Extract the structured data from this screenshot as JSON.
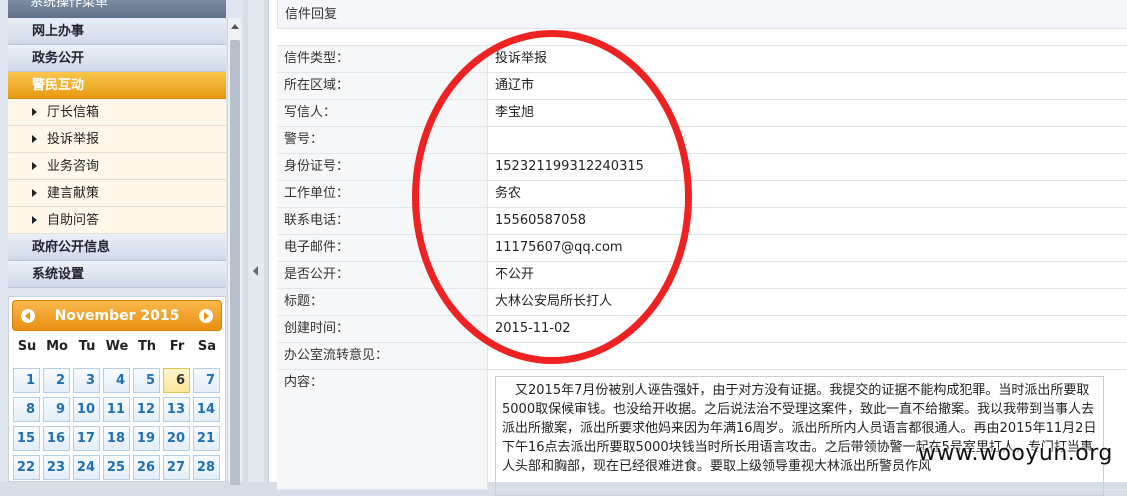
{
  "sidebar": {
    "menu_title": "系统操作菜单",
    "sections": [
      {
        "label": "网上办事"
      },
      {
        "label": "政务公开"
      },
      {
        "label": "警民互动"
      }
    ],
    "sub_items": [
      {
        "label": "厅长信箱"
      },
      {
        "label": "投诉举报"
      },
      {
        "label": "业务咨询"
      },
      {
        "label": "建言献策"
      },
      {
        "label": "自助问答"
      }
    ],
    "sections_after": [
      {
        "label": "政府公开信息"
      },
      {
        "label": "系统设置"
      }
    ]
  },
  "calendar": {
    "title": "November 2015",
    "weekdays": [
      "Su",
      "Mo",
      "Tu",
      "We",
      "Th",
      "Fr",
      "Sa"
    ],
    "week1": [
      "1",
      "2",
      "3",
      "4",
      "5",
      "6",
      "7"
    ],
    "week2": [
      "8",
      "9",
      "10",
      "11",
      "12",
      "13",
      "14"
    ],
    "week3": [
      "15",
      "16",
      "17",
      "18",
      "19",
      "20",
      "21"
    ],
    "week4": [
      "22",
      "23",
      "24",
      "25",
      "26",
      "27",
      "28"
    ],
    "today": "6"
  },
  "main": {
    "reply_title": "信件回复",
    "fields": [
      {
        "label": "信件类型：",
        "value": "投诉举报"
      },
      {
        "label": "所在区域：",
        "value": "通辽市"
      },
      {
        "label": "写信人：",
        "value": "李宝旭"
      },
      {
        "label": "警号：",
        "value": ""
      },
      {
        "label": "身份证号：",
        "value": "152321199312240315"
      },
      {
        "label": "工作单位：",
        "value": "务农"
      },
      {
        "label": "联系电话：",
        "value": "15560587058"
      },
      {
        "label": "电子邮件：",
        "value": "11175607@qq.com"
      },
      {
        "label": "是否公开：",
        "value": "不公开"
      },
      {
        "label": "标题：",
        "value": "大林公安局所长打人"
      },
      {
        "label": "创建时间：",
        "value": "2015-11-02"
      },
      {
        "label": "办公室流转意见：",
        "value": ""
      }
    ],
    "content_label": "内容：",
    "content_text": "又2015年7月份被别人诬告强奸，由于对方没有证据。我提交的证据不能构成犯罪。当时派出所要取5000取保候审钱。也没给开收据。之后说法治不受理这案件，致此一直不给撤案。我以我带到当事人去派出所撤案，派出所要求他妈来因为年满16周岁。派出所所内人员语言都很通人。再由2015年11月2日下午16点去派出所要取5000块钱当时所长用语言攻击。之后带领协警一起在5号室里打人，专门打当事人头部和胸部，现在已经很难进食。要取上级领导重视大林派出所警员作风"
  },
  "watermark": "www.wooyun.org"
}
